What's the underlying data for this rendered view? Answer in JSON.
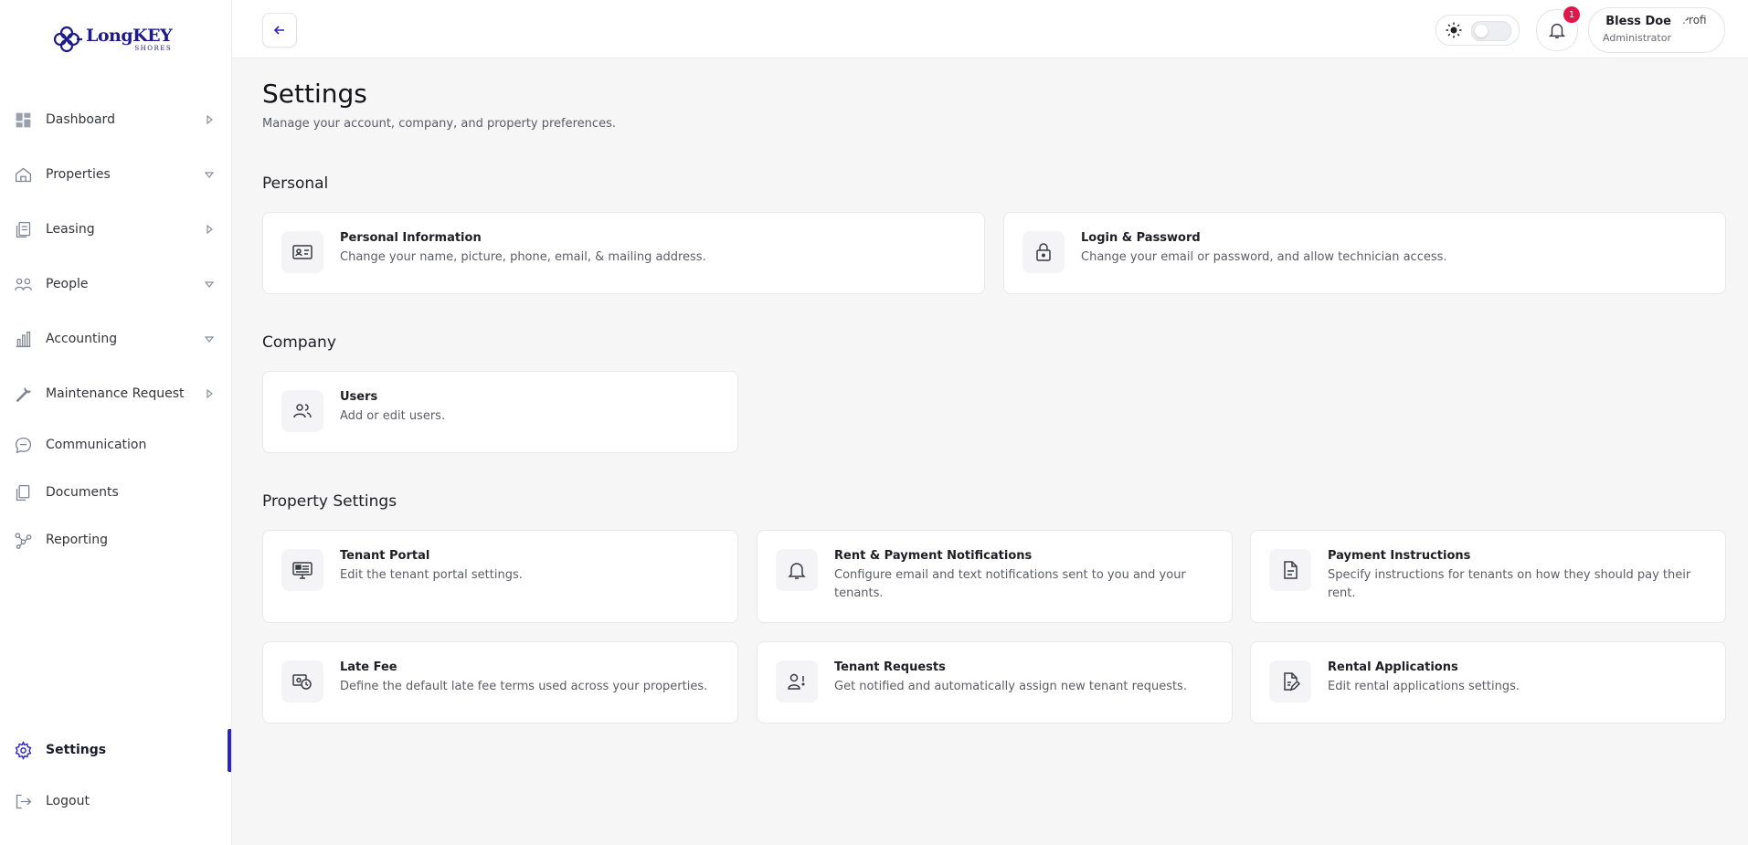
{
  "brand": {
    "name": "LongKEY",
    "sub": "SHORES",
    "color": "#1d1a8a"
  },
  "sidebar": {
    "items": [
      {
        "label": "Dashboard",
        "icon": "dashboard-icon",
        "chevron": "right"
      },
      {
        "label": "Properties",
        "icon": "house-icon",
        "chevron": "down"
      },
      {
        "label": "Leasing",
        "icon": "documents-stack-icon",
        "chevron": "right"
      },
      {
        "label": "People",
        "icon": "people-icon",
        "chevron": "down"
      },
      {
        "label": "Accounting",
        "icon": "bar-chart-icon",
        "chevron": "down"
      },
      {
        "label": "Maintenance Request",
        "icon": "wrench-icon",
        "chevron": "right"
      },
      {
        "label": "Communication",
        "icon": "chat-bubble-icon",
        "chevron": ""
      },
      {
        "label": "Documents",
        "icon": "document-icon",
        "chevron": ""
      },
      {
        "label": "Reporting",
        "icon": "nodes-icon",
        "chevron": ""
      }
    ],
    "settings": {
      "label": "Settings",
      "icon": "gear-icon",
      "active": true
    },
    "logout": {
      "label": "Logout",
      "icon": "logout-icon"
    },
    "accent_color": "#2b22c9"
  },
  "topbar": {
    "notifications_count": "1",
    "user": {
      "name": "Bless Doe",
      "role": "Administrator",
      "avatar_alt": "Profi"
    }
  },
  "page": {
    "title": "Settings",
    "subtitle": "Manage your account, company, and property preferences."
  },
  "sections": {
    "personal": {
      "title": "Personal",
      "cards": [
        {
          "title": "Personal Information",
          "desc": "Change your name, picture, phone, email, & mailing address.",
          "icon": "id-card-icon"
        },
        {
          "title": "Login & Password",
          "desc": "Change your email or password, and allow technician access.",
          "icon": "lock-icon"
        }
      ]
    },
    "company": {
      "title": "Company",
      "cards": [
        {
          "title": "Users",
          "desc": "Add or edit users.",
          "icon": "users-icon"
        }
      ]
    },
    "property": {
      "title": "Property Settings",
      "cards": [
        {
          "title": "Tenant Portal",
          "desc": "Edit the tenant portal settings.",
          "icon": "monitor-icon"
        },
        {
          "title": "Rent & Payment Notifications",
          "desc": "Configure email and text notifications sent to you and your tenants.",
          "icon": "bell-icon"
        },
        {
          "title": "Payment Instructions",
          "desc": "Specify instructions for tenants on how they should pay their rent.",
          "icon": "file-text-icon"
        },
        {
          "title": "Late Fee",
          "desc": "Define the default late fee terms used across your properties.",
          "icon": "clock-money-icon"
        },
        {
          "title": "Tenant Requests",
          "desc": "Get notified and automatically assign new tenant requests.",
          "icon": "user-alert-icon"
        },
        {
          "title": "Rental Applications",
          "desc": "Edit rental applications settings.",
          "icon": "file-edit-icon"
        }
      ]
    }
  }
}
